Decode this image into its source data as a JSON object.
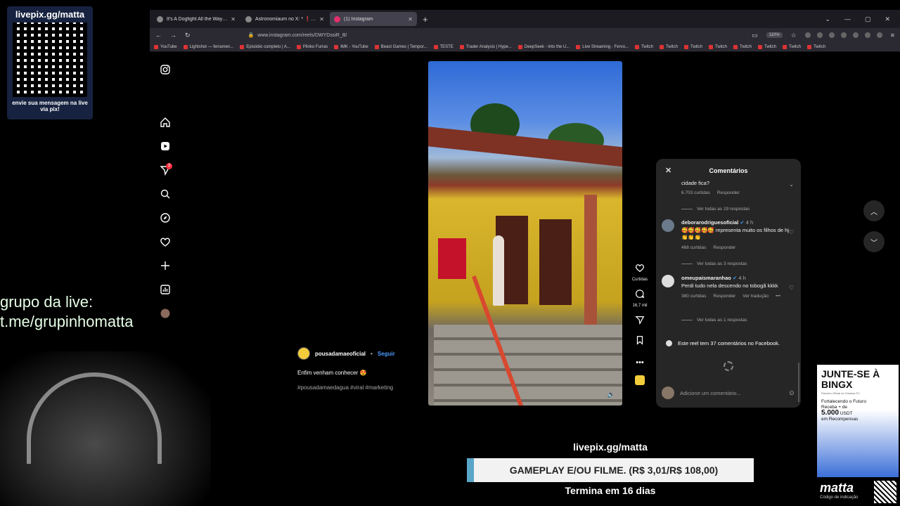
{
  "browser": {
    "tabs": [
      {
        "label": "It's A Dogfight All the Way Hom",
        "active": false
      },
      {
        "label": "Astronomiaum no X: * ❗PESQ",
        "active": false
      },
      {
        "label": "(1) Instagram",
        "active": true
      }
    ],
    "url": "www.instagram.com/reels/DWYDssiR_B/",
    "zoom": "110%",
    "bookmarks": [
      "YouTube",
      "Lightshot — ferramen...",
      "Episódio completo | A...",
      "Plinko Furras",
      "IMK - YouTube",
      "Beast Games | Tempor...",
      "TESTE",
      "Trader Analysis | Hype...",
      "DeepSeek - Into the U...",
      "Live Streaming - Fervo...",
      "Twitch",
      "Twitch",
      "Twitch",
      "Twitch",
      "Twitch",
      "Twitch",
      "Twitch",
      "Twitch"
    ]
  },
  "sidebar": {
    "notification_badge": "3"
  },
  "reel": {
    "username": "pousadamaeoficial",
    "follow_label": "Seguir",
    "caption": "Enfim venham conhecer 😍",
    "hashtags": "#pousadamaedagua #viral #marketing",
    "likes_label": "Curtidas",
    "comments_count": "16,7 mil"
  },
  "comments": {
    "title": "Comentários",
    "top_fragment": "cidade fica?",
    "top_meta": {
      "likes": "6.703 curtidas",
      "reply": "Responder"
    },
    "top_replies": "Ver todas as 19 respostas",
    "items": [
      {
        "user": "deborarodriguesoficial",
        "time": "4 h",
        "text": "🥰🥰🥰🥰🥰 representa muito os filhos de hj 👏👏👏",
        "likes": "468 curtidas",
        "reply": "Responder",
        "replies": "Ver todas as 3 respostas"
      },
      {
        "user": "omeupaismaranhao",
        "time": "4 h",
        "text": "Perdi tudo nela descendo no tobogã kkkk",
        "likes": "380 curtidas",
        "reply": "Responder",
        "translate": "Ver tradução",
        "replies": "Ver todas as 1 respostas"
      }
    ],
    "facebook_note": "Este reel tem 37 comentários no Facebook.",
    "input_placeholder": "Adicione um comentário..."
  },
  "overlay": {
    "qr_title": "livepix.gg/matta",
    "qr_footer": "envie sua mensagem na live via pix!",
    "group_line1": "grupo da live:",
    "group_line2": "t.me/grupinhomatta",
    "donation_site": "livepix.gg/matta",
    "donation_goal": "GAMEPLAY E/OU FILME. (R$ 3,01/R$ 108,00)",
    "donation_ends": "Termina em 16 dias",
    "ad_headline": "JUNTE-SE À BINGX",
    "ad_sub": "Parceiro Oficial do Chelsea FC",
    "ad_text1": "Fortalecendo o Futuro",
    "ad_text2": "Receba + de",
    "ad_amount": "5.000",
    "ad_unit": "USDT",
    "ad_text3": "em Recompensas",
    "brand": "matta",
    "brand_sub": "Código de indicação"
  }
}
